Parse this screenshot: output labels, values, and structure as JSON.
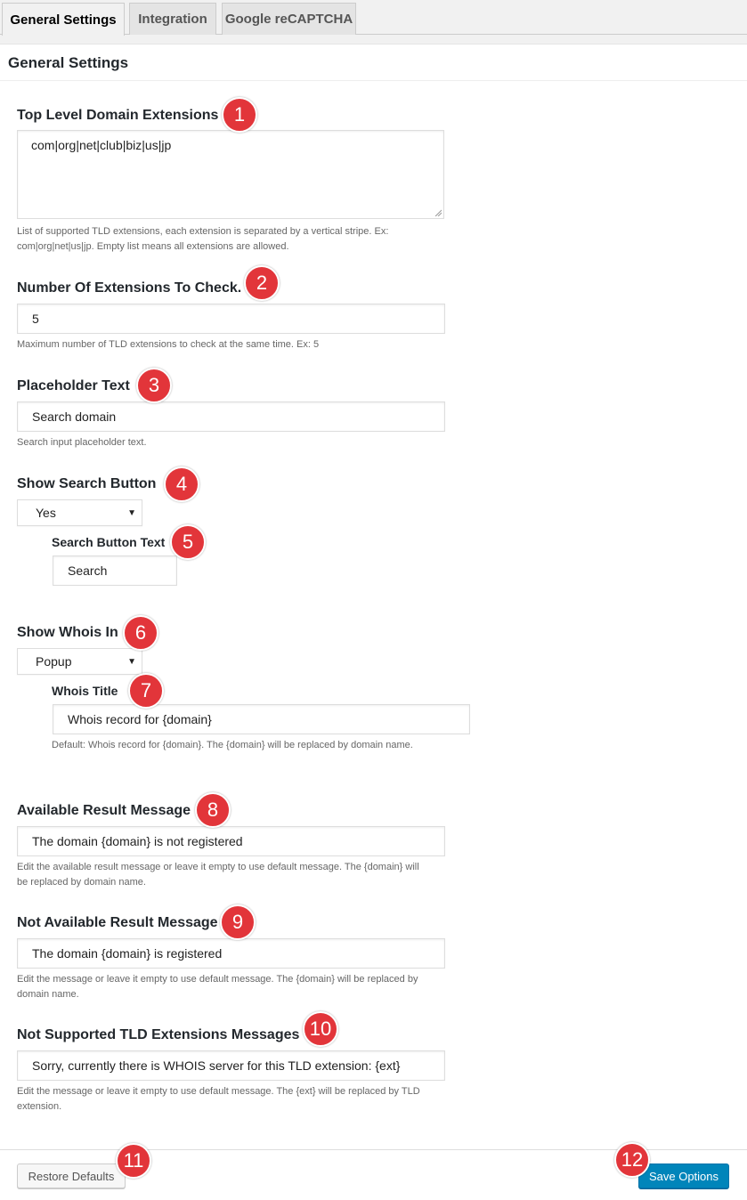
{
  "tabs": [
    {
      "label": "General Settings",
      "active": true
    },
    {
      "label": "Integration",
      "active": false
    },
    {
      "label": "Google reCAPTCHA",
      "active": false
    }
  ],
  "panel": {
    "title": "General Settings"
  },
  "fields": {
    "tld_extensions": {
      "label": "Top Level Domain Extensions",
      "value": "com|org|net|club|biz|us|jp",
      "description": "List of supported TLD extensions, each extension is separated by a vertical stripe. Ex: com|org|net|us|jp. Empty list means all extensions are allowed."
    },
    "extensions_count": {
      "label": "Number Of Extensions To Check.",
      "value": "5",
      "description": "Maximum number of TLD extensions to check at the same time. Ex: 5"
    },
    "placeholder_text": {
      "label": "Placeholder Text",
      "value": "Search domain",
      "description": "Search input placeholder text."
    },
    "show_search_button": {
      "label": "Show Search Button",
      "selected": "Yes"
    },
    "search_button_text": {
      "label": "Search Button Text",
      "value": "Search"
    },
    "show_whois_in": {
      "label": "Show Whois In",
      "selected": "Popup"
    },
    "whois_title": {
      "label": "Whois Title",
      "value": "Whois record for {domain}",
      "description": "Default: Whois record for {domain}. The {domain} will be replaced by domain name."
    },
    "available_message": {
      "label": "Available Result Message",
      "value": "The domain {domain} is not registered",
      "description": "Edit the available result message or leave it empty to use default message. The {domain} will be replaced by domain name."
    },
    "not_available_message": {
      "label": "Not Available Result Message",
      "value": "The domain {domain} is registered",
      "description": "Edit the message or leave it empty to use default message. The {domain} will be replaced by domain name."
    },
    "not_supported_message": {
      "label": "Not Supported TLD Extensions Messages",
      "value": "Sorry, currently there is WHOIS server for this TLD extension: {ext}",
      "description": "Edit the message or leave it empty to use default message. The {ext} will be replaced by TLD extension."
    }
  },
  "buttons": {
    "restore_defaults": "Restore Defaults",
    "save_options": "Save Options"
  },
  "annotations": [
    "1",
    "2",
    "3",
    "4",
    "5",
    "6",
    "7",
    "8",
    "9",
    "10",
    "11",
    "12"
  ],
  "colors": {
    "badge": "#e2353a",
    "primary_button": "#0085ba",
    "page_background": "#f1f1f1"
  }
}
